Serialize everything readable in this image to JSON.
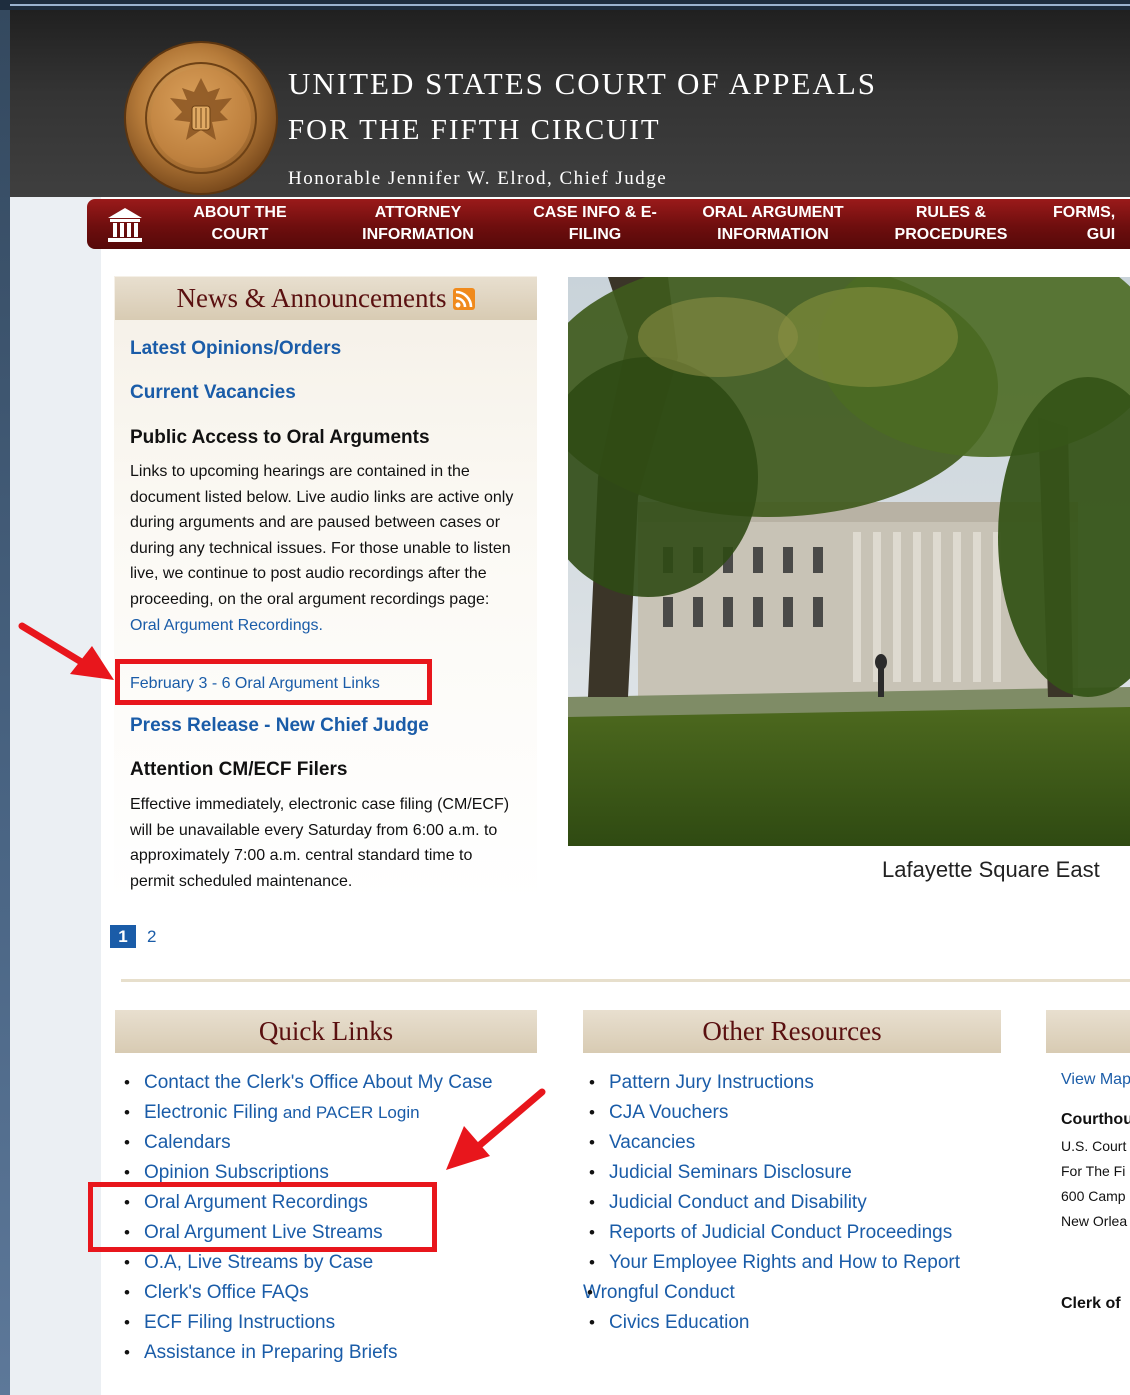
{
  "header": {
    "title_line1": "UNITED STATES COURT OF APPEALS",
    "title_line2": "FOR THE  FIFTH CIRCUIT",
    "chief_judge": "Honorable Jennifer W. Elrod, Chief Judge",
    "seal_icon": "court-seal"
  },
  "nav": {
    "home_icon": "courthouse-icon",
    "items": [
      {
        "line1": "ABOUT THE",
        "line2": "COURT"
      },
      {
        "line1": "ATTORNEY",
        "line2": "INFORMATION"
      },
      {
        "line1": "CASE INFO & E-",
        "line2": "FILING"
      },
      {
        "line1": "ORAL ARGUMENT",
        "line2": "INFORMATION"
      },
      {
        "line1": "RULES &",
        "line2": "PROCEDURES"
      },
      {
        "line1": "FORMS,",
        "line2": "GUI"
      }
    ]
  },
  "news": {
    "title": "News & Announcements",
    "latest_opinions": "Latest Opinions/Orders",
    "current_vacancies": "Current Vacancies",
    "oral_heading": "Public Access to Oral Arguments",
    "oral_text": "Links to upcoming hearings are contained in the document listed below.  Live audio links are active only during arguments and are paused between cases or during any technical issues.  For those unable to listen live, we continue to post audio recordings after the proceeding, on the oral argument recordings page: ",
    "oral_recordings_link": "Oral Argument Recordings.",
    "feb_link": "February 3 - 6 Oral Argument Links",
    "press_release": "Press Release - New Chief Judge",
    "cmecf_heading": "Attention CM/ECF Filers",
    "cmecf_text": "Effective immediately, electronic case filing (CM/ECF) will be unavailable every Saturday from 6:00 a.m. to approximately 7:00 a.m. central standard time to permit scheduled maintenance."
  },
  "photo": {
    "caption": "Lafayette Square East"
  },
  "pager": {
    "page1": "1",
    "page2": "2",
    "current": 1
  },
  "quick_links": {
    "title": "Quick Links",
    "items": [
      "Contact the Clerk's Office About My Case",
      "Electronic Filing",
      "O.A, Live Streams by Case",
      "Oral Argument Recordings",
      "Oral Argument Live Streams",
      "Calendars",
      "Opinion Subscriptions",
      "Clerk's Office FAQs",
      "ECF Filing Instructions",
      "Assistance in Preparing Briefs"
    ],
    "efiling_suffix": " and PACER Login"
  },
  "other_resources": {
    "title": "Other Resources",
    "items": [
      "Pattern Jury Instructions",
      "CJA Vouchers",
      "Vacancies",
      "Judicial Seminars Disclosure",
      "Judicial Conduct and Disability",
      "Reports of Judicial Conduct Proceedings",
      "Your Employee Rights and How to Report",
      "Wrongful Conduct",
      "Civics Education"
    ]
  },
  "contact": {
    "view_map": "View Map",
    "courthouse": "Courthouse",
    "line1": "U.S. Court",
    "line2": "For The Fi",
    "line3": "600 Camp",
    "line4": "New Orlea",
    "clerk": "Clerk of"
  },
  "colors": {
    "nav_red": "#7a1212",
    "link_blue": "#1a5ca8",
    "annotation_red": "#e8161c",
    "section_tan": "#ddd2bd",
    "heading_maroon": "#5a1010"
  }
}
